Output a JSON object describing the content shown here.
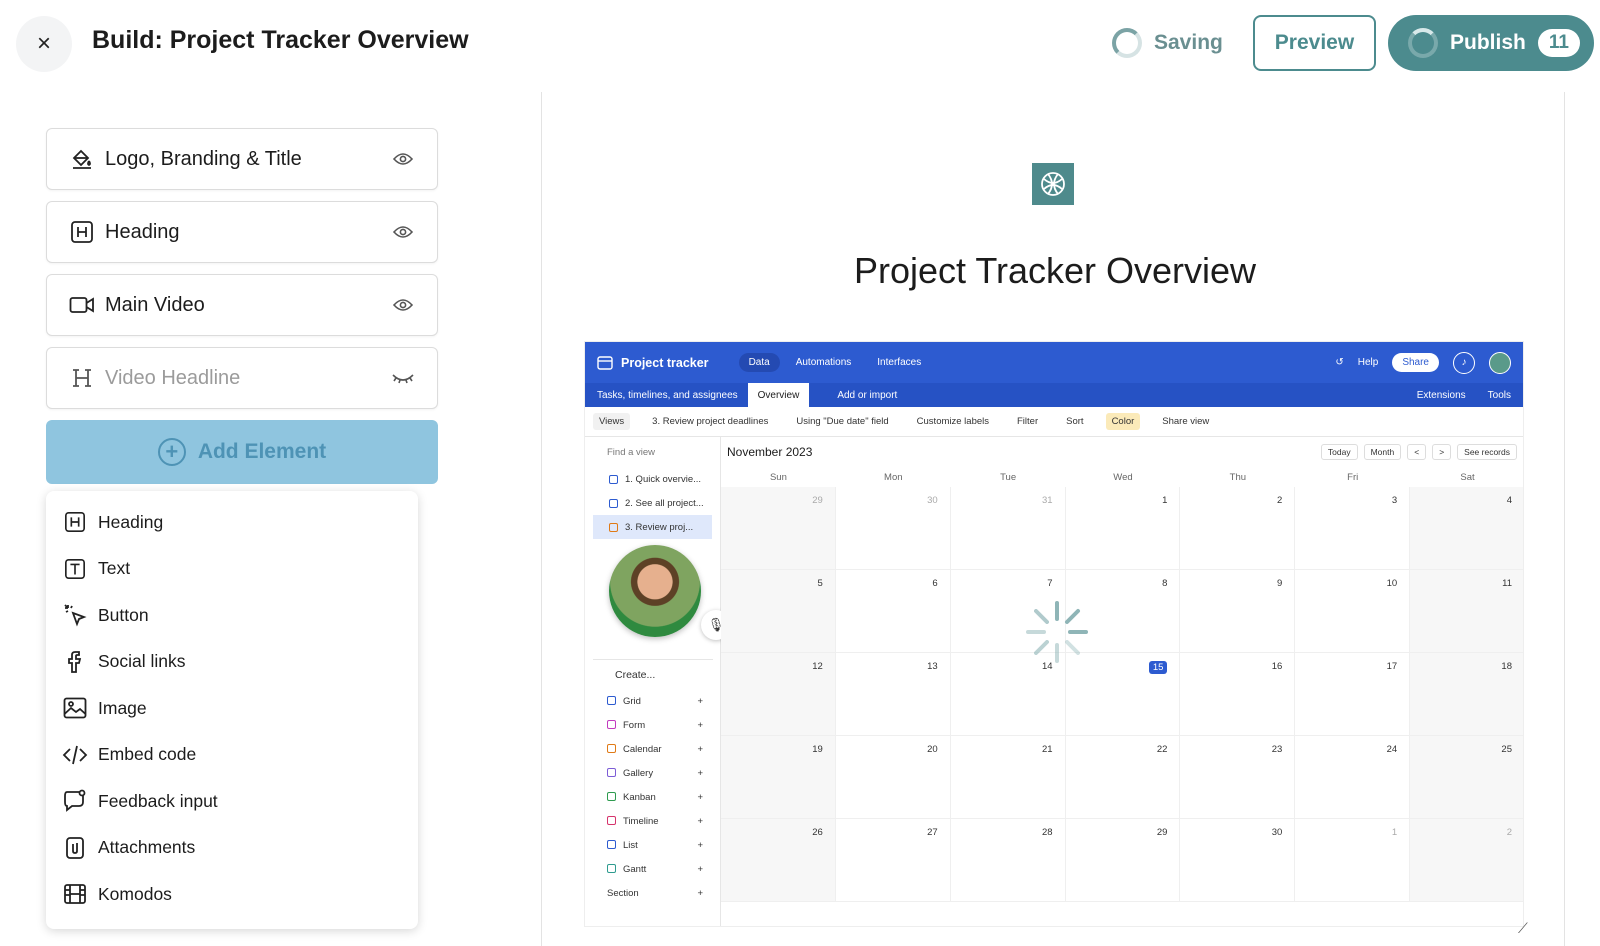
{
  "header": {
    "close_label": "×",
    "title": "Build: Project Tracker Overview",
    "saving_label": "Saving",
    "preview_label": "Preview",
    "publish_label": "Publish",
    "publish_count": "11",
    "accent_color": "#4c8b8e"
  },
  "elements": [
    {
      "label": "Logo, Branding & Title",
      "icon": "paint-bucket-icon",
      "visible": true
    },
    {
      "label": "Heading",
      "icon": "heading-h-icon",
      "visible": true
    },
    {
      "label": "Main Video",
      "icon": "video-camera-icon",
      "visible": true
    },
    {
      "label": "Video Headline",
      "icon": "heading-serif-h-icon",
      "visible": false
    }
  ],
  "add_element_label": "Add Element",
  "add_menu": [
    {
      "label": "Heading",
      "icon": "heading-h-icon"
    },
    {
      "label": "Text",
      "icon": "text-t-icon"
    },
    {
      "label": "Button",
      "icon": "cursor-click-icon"
    },
    {
      "label": "Social links",
      "icon": "facebook-icon"
    },
    {
      "label": "Image",
      "icon": "image-icon"
    },
    {
      "label": "Embed code",
      "icon": "code-icon"
    },
    {
      "label": "Feedback input",
      "icon": "chat-bubble-icon"
    },
    {
      "label": "Attachments",
      "icon": "paperclip-icon"
    },
    {
      "label": "Komodos",
      "icon": "film-strip-icon"
    }
  ],
  "preview": {
    "title": "Project Tracker Overview"
  },
  "video": {
    "app_name": "Project tracker",
    "nav": [
      "Data",
      "Automations",
      "Interfaces"
    ],
    "help": "Help",
    "share": "Share",
    "sub_table": "Tasks, timelines, and assignees",
    "sub_tab": "Overview",
    "add_import": "Add or import",
    "extensions": "Extensions",
    "tools": "Tools",
    "toolbar": [
      "Views",
      "3. Review project deadlines",
      "Using \"Due date\" field",
      "Customize labels",
      "Filter",
      "Sort",
      "Color",
      "Share view"
    ],
    "find_view": "Find a view",
    "views": [
      "1. Quick overvie...",
      "2. See all project...",
      "3. Review proj..."
    ],
    "create_label": "Create...",
    "create_items": [
      {
        "label": "Grid",
        "color": "#2d5bd0"
      },
      {
        "label": "Form",
        "color": "#c23bbf"
      },
      {
        "label": "Calendar",
        "color": "#e07a16"
      },
      {
        "label": "Gallery",
        "color": "#7c5cd6"
      },
      {
        "label": "Kanban",
        "color": "#2e9b4f"
      },
      {
        "label": "Timeline",
        "color": "#d6336c"
      },
      {
        "label": "List",
        "color": "#2d5bd0"
      },
      {
        "label": "Gantt",
        "color": "#2e9b8f"
      },
      {
        "label": "Section",
        "color": ""
      }
    ],
    "month_label": "November 2023",
    "cal_buttons": [
      "Today",
      "Month",
      "<",
      ">",
      "See records"
    ],
    "weekdays": [
      "Sun",
      "Mon",
      "Tue",
      "Wed",
      "Thu",
      "Fri",
      "Sat"
    ],
    "weeks": [
      [
        "29",
        "30",
        "31",
        "1",
        "2",
        "3",
        "4"
      ],
      [
        "5",
        "6",
        "7",
        "8",
        "9",
        "10",
        "11"
      ],
      [
        "12",
        "13",
        "14",
        "15",
        "16",
        "17",
        "18"
      ],
      [
        "19",
        "20",
        "21",
        "22",
        "23",
        "24",
        "25"
      ],
      [
        "26",
        "27",
        "28",
        "29",
        "30",
        "1",
        "2"
      ]
    ],
    "today": "15"
  }
}
